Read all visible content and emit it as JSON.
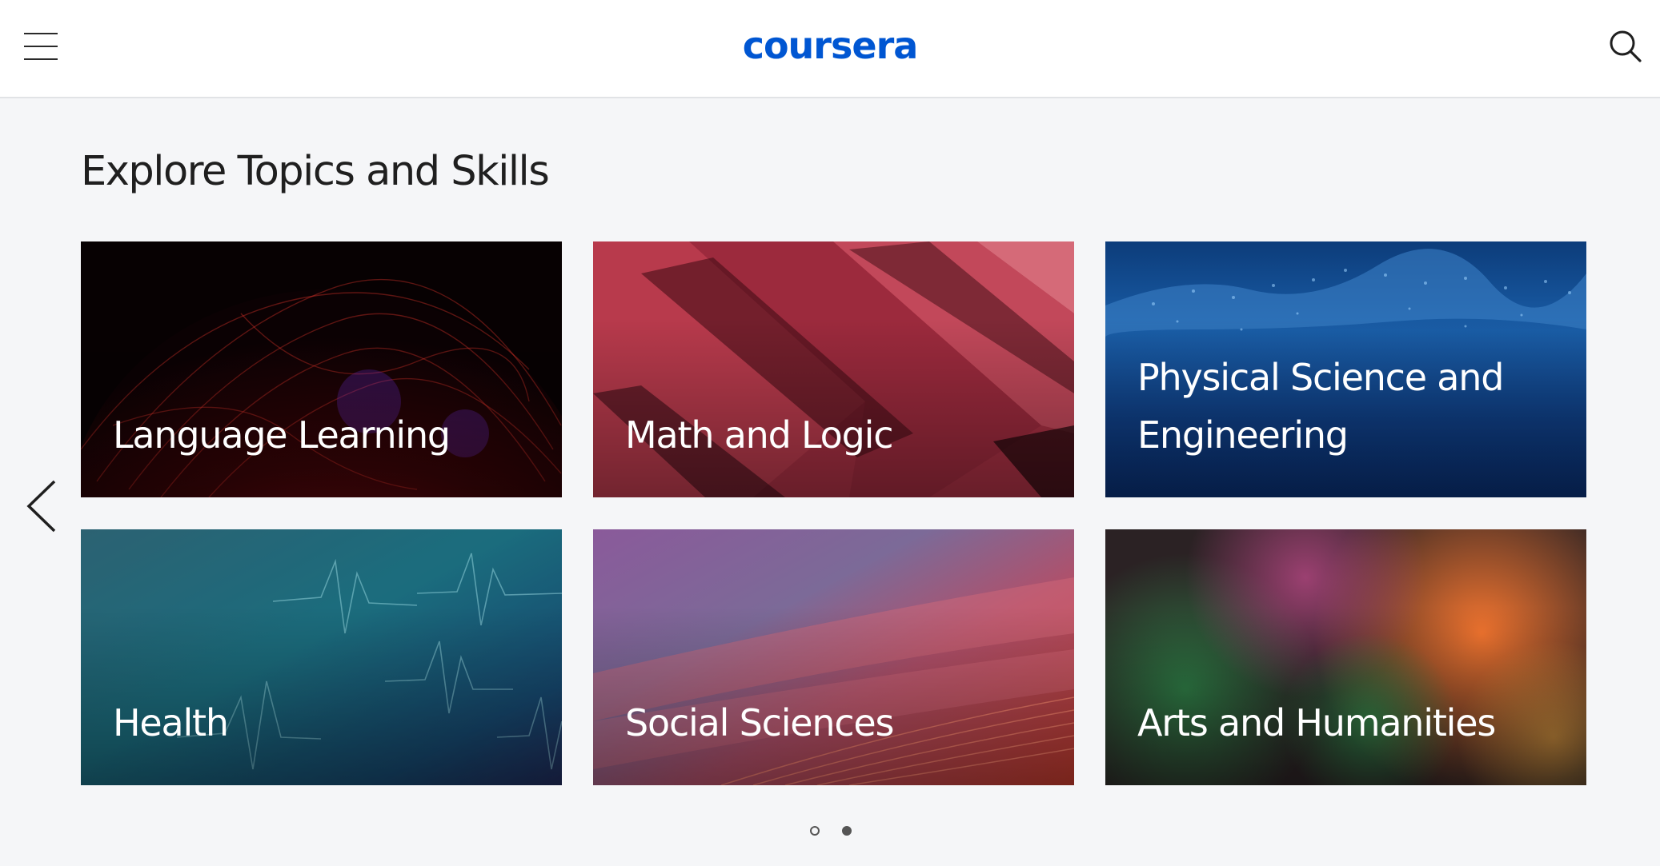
{
  "header": {
    "logo_text": "coursera",
    "brand_color": "#0056d2",
    "menu_icon": "hamburger-menu-icon",
    "search_icon": "search-icon"
  },
  "main": {
    "section_title": "Explore Topics and Skills",
    "carousel": {
      "prev_icon": "chevron-left-icon",
      "cards": [
        {
          "label": "Language Learning"
        },
        {
          "label": "Math and Logic"
        },
        {
          "label": "Physical Science and Engineering"
        },
        {
          "label": "Health"
        },
        {
          "label": "Social Sciences"
        },
        {
          "label": "Arts and Humanities"
        }
      ],
      "pages": 2,
      "active_page": 2
    }
  }
}
